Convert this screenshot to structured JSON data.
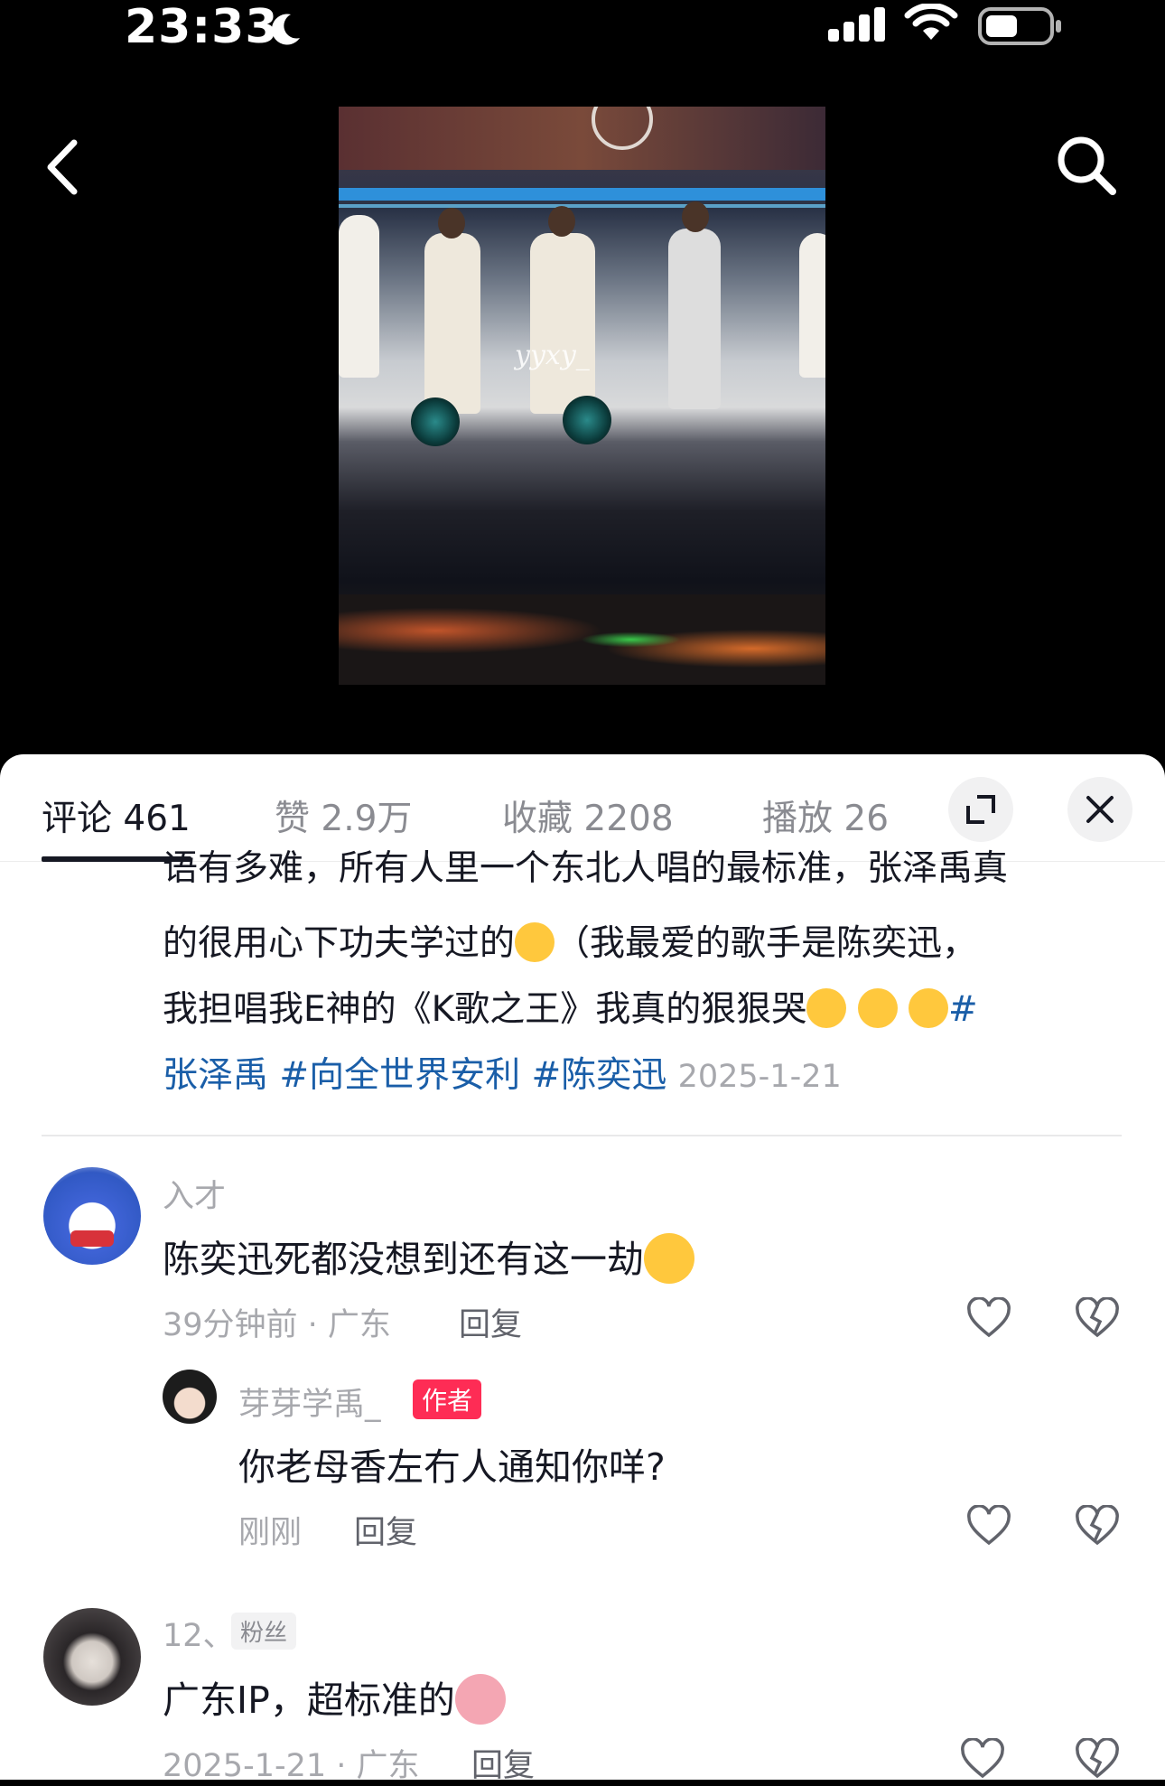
{
  "status_bar": {
    "time": "23:33"
  },
  "video": {
    "watermark": "yyxy_"
  },
  "tabs": {
    "comments": "评论 461",
    "likes": "赞 2.9万",
    "favorites": "收藏 2208",
    "plays": "播放 26"
  },
  "post": {
    "line1": "语有多难，所有人里一个东北人唱的最标准，张泽禹真",
    "line2a": "的很用心下功夫学过的",
    "line2b": "（我最爱的歌手是陈奕迅，",
    "line3a": "我担唱我E神的《K歌之王》我真的狠狠哭",
    "line3b": "#",
    "line4_tag1": "张泽禹",
    "line4_tag2": "#向全世界安利",
    "line4_tag3": "#陈奕迅",
    "date": "2025-1-21"
  },
  "comments": [
    {
      "username": "入才",
      "text": "陈奕迅死都没想到还有这一劫",
      "meta": "39分钟前 · 广东",
      "reply_label": "回复",
      "replies": [
        {
          "username": "芽芽学禹_",
          "badge": "作者",
          "text": "你老母香左冇人通知你咩?",
          "meta": "刚刚",
          "reply_label": "回复"
        }
      ]
    },
    {
      "username": "12、",
      "badge": "粉丝",
      "text": "广东IP，超标准的",
      "meta": "2025-1-21 · 广东",
      "reply_label": "回复"
    }
  ]
}
